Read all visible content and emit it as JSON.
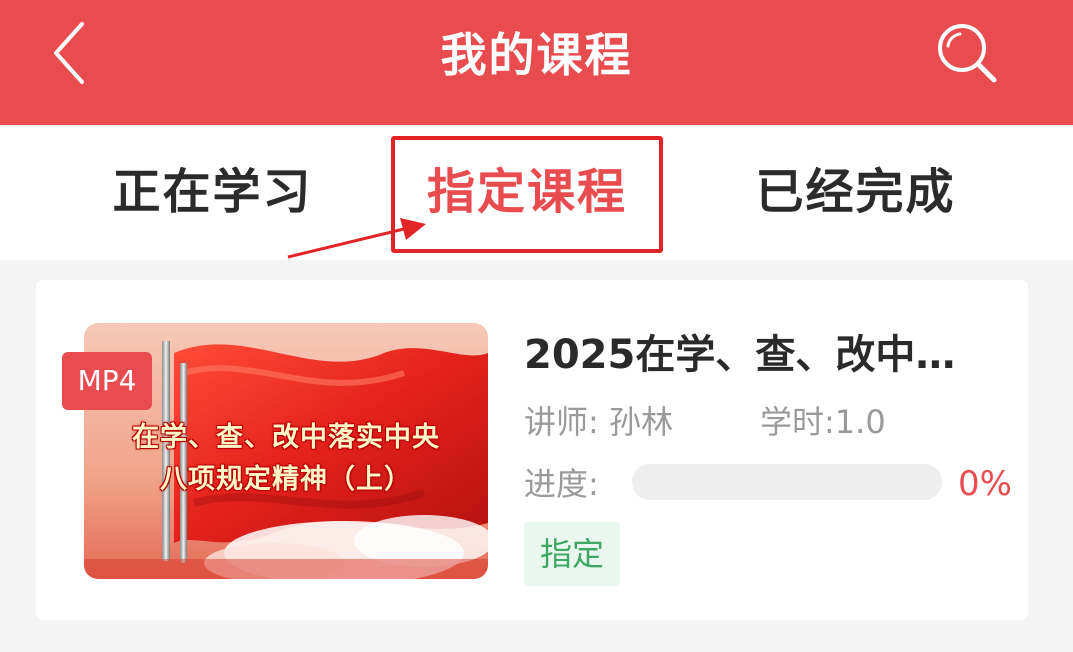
{
  "header": {
    "title": "我的课程",
    "back_icon": "chevron-left-icon",
    "search_icon": "search-icon",
    "bg_color": "#e84c4f"
  },
  "tabs": [
    {
      "label": "正在学习",
      "active": false
    },
    {
      "label": "指定课程",
      "active": true
    },
    {
      "label": "已经完成",
      "active": false
    }
  ],
  "course": {
    "badge": "MP4",
    "thumb_caption_line1": "在学、查、改中落实中央",
    "thumb_caption_line2": "八项规定精神（上）",
    "title": "2025在学、查、改中…",
    "teacher": "讲师: 孙林",
    "hours": "学时:1.0",
    "progress_label": "进度:",
    "progress_value": 0,
    "progress_text": "0%",
    "tag": "指定"
  },
  "colors": {
    "accent": "#e84c4f",
    "tag_green": "#3fa865",
    "annotation_red": "#e22426"
  }
}
